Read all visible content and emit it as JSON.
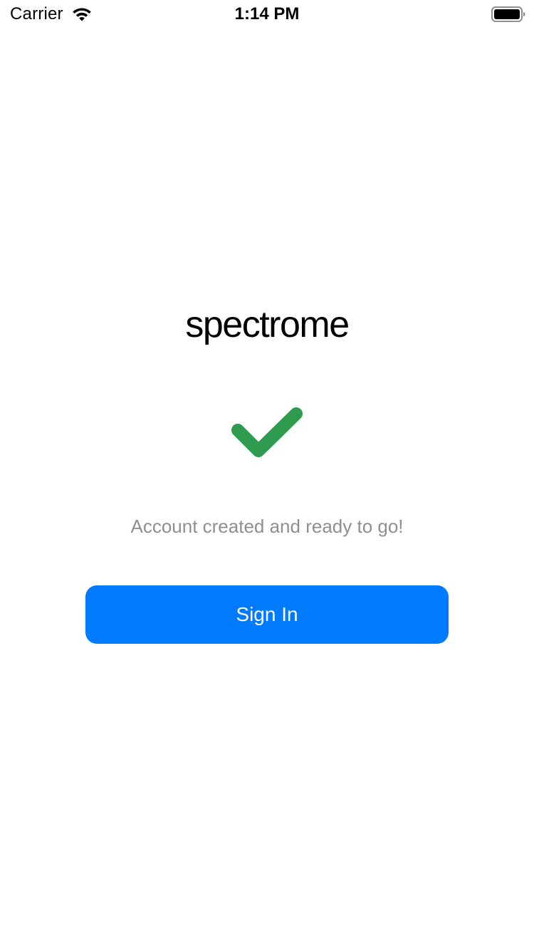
{
  "status_bar": {
    "carrier": "Carrier",
    "time": "1:14 PM",
    "wifi_icon": "wifi-icon",
    "battery_icon": "battery-icon"
  },
  "brand": {
    "name": "spectrome"
  },
  "success": {
    "icon": "checkmark-icon",
    "icon_color": "#2e9b4f",
    "message": "Account created and ready to go!"
  },
  "actions": {
    "sign_in_label": "Sign In",
    "button_color": "#007aff"
  }
}
